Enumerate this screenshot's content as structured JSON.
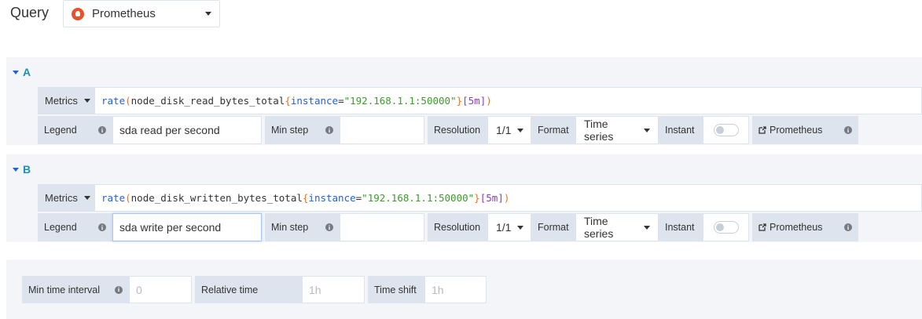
{
  "query": {
    "label": "Query",
    "datasource": "Prometheus"
  },
  "queries": [
    {
      "letter": "A",
      "metrics_label": "Metrics",
      "expr": {
        "fn": "rate",
        "metric": "node_disk_read_bytes_total",
        "key": "instance",
        "value": "\"192.168.1.1:50000\"",
        "range": "[5m]"
      },
      "legend_label": "Legend",
      "legend_value": "sda read per second",
      "min_step_label": "Min step",
      "min_step_value": "",
      "resolution_label": "Resolution",
      "resolution_value": "1/1",
      "format_label": "Format",
      "format_value": "Time series",
      "instant_label": "Instant",
      "instant_on": false,
      "link_label": "Prometheus"
    },
    {
      "letter": "B",
      "metrics_label": "Metrics",
      "expr": {
        "fn": "rate",
        "metric": "node_disk_written_bytes_total",
        "key": "instance",
        "value": "\"192.168.1.1:50000\"",
        "range": "[5m]"
      },
      "legend_label": "Legend",
      "legend_value": "sda write per second",
      "min_step_label": "Min step",
      "min_step_value": "",
      "resolution_label": "Resolution",
      "resolution_value": "1/1",
      "format_label": "Format",
      "format_value": "Time series",
      "instant_label": "Instant",
      "instant_on": false,
      "link_label": "Prometheus"
    }
  ],
  "options": {
    "min_interval_label": "Min time interval",
    "min_interval_placeholder": "0",
    "relative_time_label": "Relative time",
    "relative_time_placeholder": "1h",
    "time_shift_label": "Time shift",
    "time_shift_placeholder": "1h"
  },
  "colors": {
    "accent": "#1f62e0",
    "panel_bg": "#f4f5f8",
    "label_bg": "#dde4ed",
    "string": "#3d9b2c",
    "brace": "#e0752d",
    "range": "#8f3bb8"
  },
  "icons": {
    "datasource": "prometheus-logo-icon",
    "info": "info-icon",
    "external": "external-link-icon",
    "caret": "caret-down-icon"
  }
}
